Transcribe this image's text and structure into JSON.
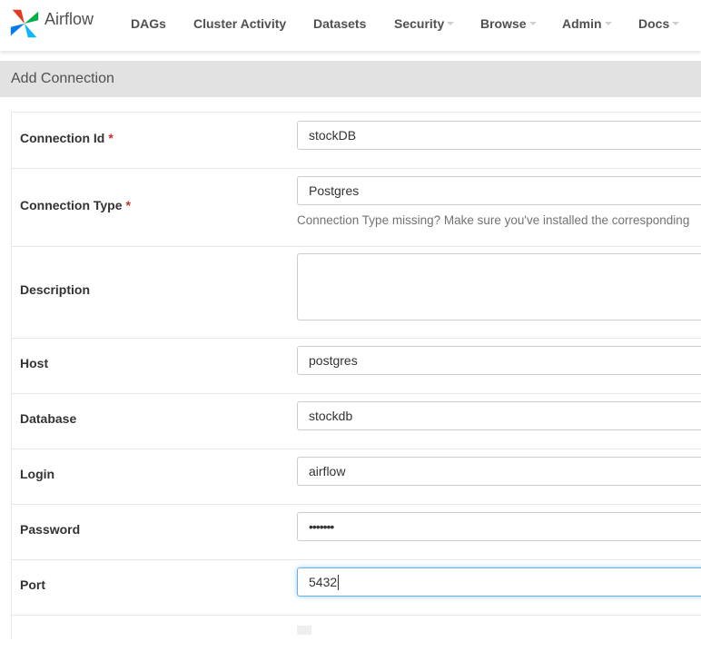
{
  "app": {
    "name": "Airflow"
  },
  "navbar": {
    "items": [
      {
        "label": "DAGs",
        "dropdown": false
      },
      {
        "label": "Cluster Activity",
        "dropdown": false
      },
      {
        "label": "Datasets",
        "dropdown": false
      },
      {
        "label": "Security",
        "dropdown": true
      },
      {
        "label": "Browse",
        "dropdown": true
      },
      {
        "label": "Admin",
        "dropdown": true
      },
      {
        "label": "Docs",
        "dropdown": true
      }
    ]
  },
  "page": {
    "title": "Add Connection"
  },
  "form": {
    "required_marker": "*",
    "connection_id": {
      "label": "Connection Id",
      "value": "stockDB",
      "required": true
    },
    "connection_type": {
      "label": "Connection Type",
      "value": "Postgres",
      "required": true,
      "help": "Connection Type missing? Make sure you've installed the corresponding"
    },
    "description": {
      "label": "Description",
      "value": ""
    },
    "host": {
      "label": "Host",
      "value": "postgres"
    },
    "database": {
      "label": "Database",
      "value": "stockdb"
    },
    "login": {
      "label": "Login",
      "value": "airflow"
    },
    "password": {
      "label": "Password",
      "value": "•••••••"
    },
    "port": {
      "label": "Port",
      "value": "5432",
      "focused": true
    }
  },
  "colors": {
    "accent_focus": "#66afe9",
    "required": "#c9302c",
    "header_bg": "#e2e2e2"
  }
}
